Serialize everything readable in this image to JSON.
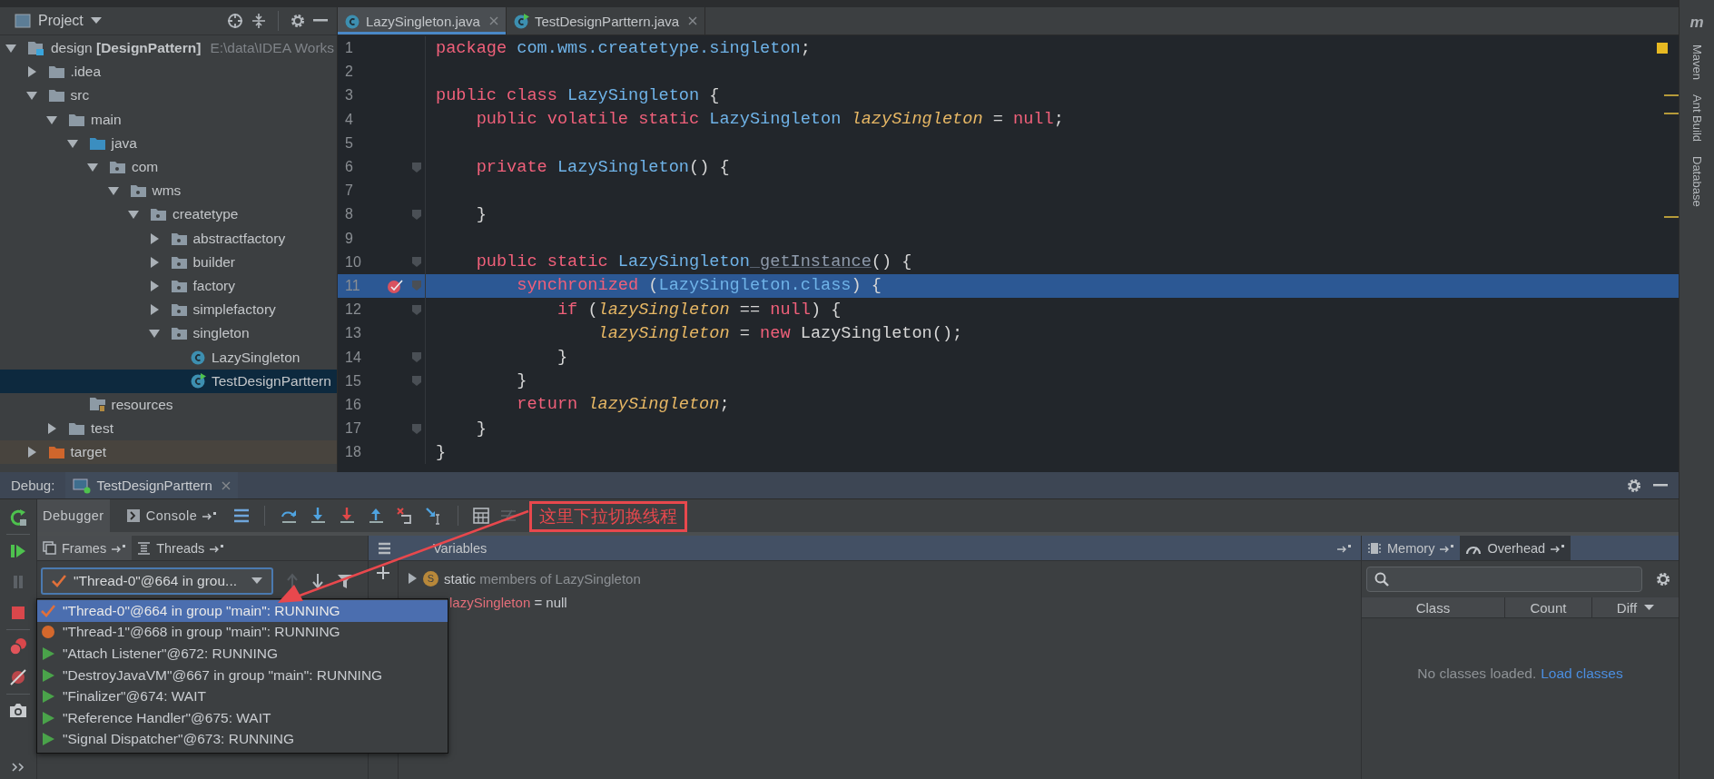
{
  "project": {
    "title": "Project",
    "tree": [
      {
        "label": "design **[DesignPattern]**",
        "path": "E:\\data\\IDEA Works",
        "kind": "module",
        "expanded": true,
        "selected": false,
        "children": [
          {
            "label": ".idea",
            "kind": "folder",
            "expanded": false,
            "selected": false
          },
          {
            "label": "src",
            "kind": "folder",
            "expanded": true,
            "selected": false,
            "children": [
              {
                "label": "main",
                "kind": "folder",
                "expanded": true,
                "selected": false,
                "children": [
                  {
                    "label": "java",
                    "kind": "source",
                    "expanded": true,
                    "selected": false,
                    "children": [
                      {
                        "label": "com",
                        "kind": "package",
                        "expanded": true,
                        "selected": false,
                        "children": [
                          {
                            "label": "wms",
                            "kind": "package",
                            "expanded": true,
                            "selected": false,
                            "children": [
                              {
                                "label": "createtype",
                                "kind": "package",
                                "expanded": true,
                                "selected": false,
                                "children": [
                                  {
                                    "label": "abstractfactory",
                                    "kind": "package",
                                    "expanded": false,
                                    "selected": false
                                  },
                                  {
                                    "label": "builder",
                                    "kind": "package",
                                    "expanded": false,
                                    "selected": false
                                  },
                                  {
                                    "label": "factory",
                                    "kind": "package",
                                    "expanded": false,
                                    "selected": false
                                  },
                                  {
                                    "label": "simplefactory",
                                    "kind": "package",
                                    "expanded": false,
                                    "selected": false
                                  },
                                  {
                                    "label": "singleton",
                                    "kind": "package",
                                    "expanded": true,
                                    "selected": false,
                                    "children": [
                                      {
                                        "label": "LazySingleton",
                                        "kind": "class",
                                        "selected": false
                                      },
                                      {
                                        "label": "TestDesignParttern",
                                        "kind": "runnable",
                                        "selected": true
                                      }
                                    ]
                                  }
                                ]
                              }
                            ]
                          }
                        ]
                      }
                    ]
                  },
                  {
                    "label": "resources",
                    "kind": "resources",
                    "selected": false
                  }
                ]
              },
              {
                "label": "test",
                "kind": "folder",
                "expanded": false,
                "selected": false
              }
            ]
          },
          {
            "label": "target",
            "kind": "excluded",
            "expanded": false,
            "selected": false
          }
        ]
      }
    ]
  },
  "editor": {
    "tabs": [
      {
        "label": "LazySingleton.java",
        "kind": "class",
        "selected": true
      },
      {
        "label": "TestDesignParttern.java",
        "kind": "runnable",
        "selected": false
      }
    ],
    "lines": [
      {
        "number": "1",
        "selected": false,
        "fold": false,
        "breakpoint": false,
        "tokens": [
          {
            "kind": "keyword",
            "text": "package"
          },
          {
            "kind": "type",
            "text": " com.wms.createtype.singleton"
          },
          {
            "kind": "plain",
            "text": ";"
          }
        ]
      },
      {
        "number": "2",
        "selected": false,
        "fold": false,
        "breakpoint": false
      },
      {
        "number": "3",
        "selected": false,
        "fold": false,
        "breakpoint": false,
        "tokens": [
          {
            "kind": "keyword",
            "text": "public class"
          },
          {
            "kind": "type",
            "text": " LazySingleton"
          },
          {
            "kind": "plain",
            "text": " {"
          }
        ]
      },
      {
        "number": "4",
        "selected": false,
        "fold": false,
        "breakpoint": false,
        "tokens": [
          {
            "kind": "keyword",
            "text": "    public volatile static"
          },
          {
            "kind": "type",
            "text": " LazySingleton"
          },
          {
            "kind": "field",
            "text": " lazySingleton"
          },
          {
            "kind": "plain",
            "text": " = "
          },
          {
            "kind": "keyword",
            "text": "null"
          },
          {
            "kind": "plain",
            "text": ";"
          }
        ]
      },
      {
        "number": "5",
        "selected": false,
        "fold": false,
        "breakpoint": false
      },
      {
        "number": "6",
        "selected": false,
        "fold": true,
        "breakpoint": false,
        "tokens": [
          {
            "kind": "keyword",
            "text": "    private"
          },
          {
            "kind": "type",
            "text": " LazySingleton"
          },
          {
            "kind": "plain",
            "text": "() {"
          }
        ]
      },
      {
        "number": "7",
        "selected": false,
        "fold": false,
        "breakpoint": false
      },
      {
        "number": "8",
        "selected": false,
        "fold": true,
        "breakpoint": false,
        "tokens": [
          {
            "kind": "plain",
            "text": "    }"
          }
        ]
      },
      {
        "number": "9",
        "selected": false,
        "fold": false,
        "breakpoint": false
      },
      {
        "number": "10",
        "selected": false,
        "fold": true,
        "breakpoint": false,
        "tokens": [
          {
            "kind": "keyword",
            "text": "    public static"
          },
          {
            "kind": "type",
            "text": " LazySingleton"
          },
          {
            "kind": "method",
            "text": " getInstance"
          },
          {
            "kind": "plain",
            "text": "() {"
          }
        ]
      },
      {
        "number": "11",
        "selected": true,
        "fold": true,
        "breakpoint": true,
        "tokens": [
          {
            "kind": "keyword",
            "text": "        synchronized"
          },
          {
            "kind": "plain",
            "text": " ("
          },
          {
            "kind": "type",
            "text": "LazySingleton.class"
          },
          {
            "kind": "plain",
            "text": ") {"
          }
        ]
      },
      {
        "number": "12",
        "selected": false,
        "fold": true,
        "breakpoint": false,
        "tokens": [
          {
            "kind": "keyword",
            "text": "            if"
          },
          {
            "kind": "plain",
            "text": " ("
          },
          {
            "kind": "field",
            "text": "lazySingleton"
          },
          {
            "kind": "plain",
            "text": " == "
          },
          {
            "kind": "keyword",
            "text": "null"
          },
          {
            "kind": "plain",
            "text": ") {"
          }
        ]
      },
      {
        "number": "13",
        "selected": false,
        "fold": false,
        "breakpoint": false,
        "tokens": [
          {
            "kind": "field",
            "text": "                lazySingleton"
          },
          {
            "kind": "plain",
            "text": " = "
          },
          {
            "kind": "keyword",
            "text": "new"
          },
          {
            "kind": "plain",
            "text": " LazySingleton();"
          }
        ]
      },
      {
        "number": "14",
        "selected": false,
        "fold": true,
        "breakpoint": false,
        "tokens": [
          {
            "kind": "plain",
            "text": "            }"
          }
        ]
      },
      {
        "number": "15",
        "selected": false,
        "fold": true,
        "breakpoint": false,
        "tokens": [
          {
            "kind": "plain",
            "text": "        }"
          }
        ]
      },
      {
        "number": "16",
        "selected": false,
        "fold": false,
        "breakpoint": false,
        "tokens": [
          {
            "kind": "keyword",
            "text": "        return"
          },
          {
            "kind": "field",
            "text": " lazySingleton"
          },
          {
            "kind": "plain",
            "text": ";"
          }
        ]
      },
      {
        "number": "17",
        "selected": false,
        "fold": true,
        "breakpoint": false,
        "tokens": [
          {
            "kind": "plain",
            "text": "    }"
          }
        ]
      },
      {
        "number": "18",
        "selected": false,
        "fold": false,
        "breakpoint": false,
        "tokens": [
          {
            "kind": "plain",
            "text": "}"
          }
        ]
      }
    ]
  },
  "side_logo": "m",
  "side_tools": [
    "Maven",
    "Ant Build",
    "Database"
  ],
  "debug": {
    "label": "Debug:",
    "session": "TestDesignParttern",
    "tabs": [
      {
        "label": "Debugger",
        "selected": true
      },
      {
        "label": "Console",
        "selected": false
      }
    ],
    "frame_tabs": [
      {
        "label": "Frames",
        "selected": true
      },
      {
        "label": "Threads",
        "selected": false
      }
    ],
    "variables_title": "Variables",
    "thread_value": "\"Thread-0\"@664 in grou...",
    "threads": [
      {
        "label": "\"Thread-0\"@664 in group \"main\": RUNNING",
        "kind": "current",
        "selected": true
      },
      {
        "label": "\"Thread-1\"@668 in group \"main\": RUNNING",
        "kind": "suspended",
        "selected": false
      },
      {
        "label": "\"Attach Listener\"@672: RUNNING",
        "kind": "running",
        "selected": false
      },
      {
        "label": "\"DestroyJavaVM\"@667 in group \"main\": RUNNING",
        "kind": "running",
        "selected": false
      },
      {
        "label": "\"Finalizer\"@674: WAIT",
        "kind": "running",
        "selected": false
      },
      {
        "label": "\"Reference Handler\"@675: WAIT",
        "kind": "running",
        "selected": false
      },
      {
        "label": "\"Signal Dispatcher\"@673: RUNNING",
        "kind": "running",
        "selected": false
      }
    ],
    "variables": [
      {
        "kind": "static",
        "name": "static",
        "detail": "members of LazySingleton",
        "badge": "S"
      },
      {
        "kind": "field",
        "name": "lazySingleton",
        "value": " = null"
      }
    ],
    "memory_tabs": [
      {
        "label": "Memory",
        "selected": false
      },
      {
        "label": "Overhead",
        "selected": true
      }
    ],
    "memory_columns": [
      "Class",
      "Count",
      "Diff"
    ],
    "memory_empty": "No classes loaded.",
    "memory_link": "Load classes"
  },
  "annotation": {
    "text": "这里下拉切换线程"
  }
}
